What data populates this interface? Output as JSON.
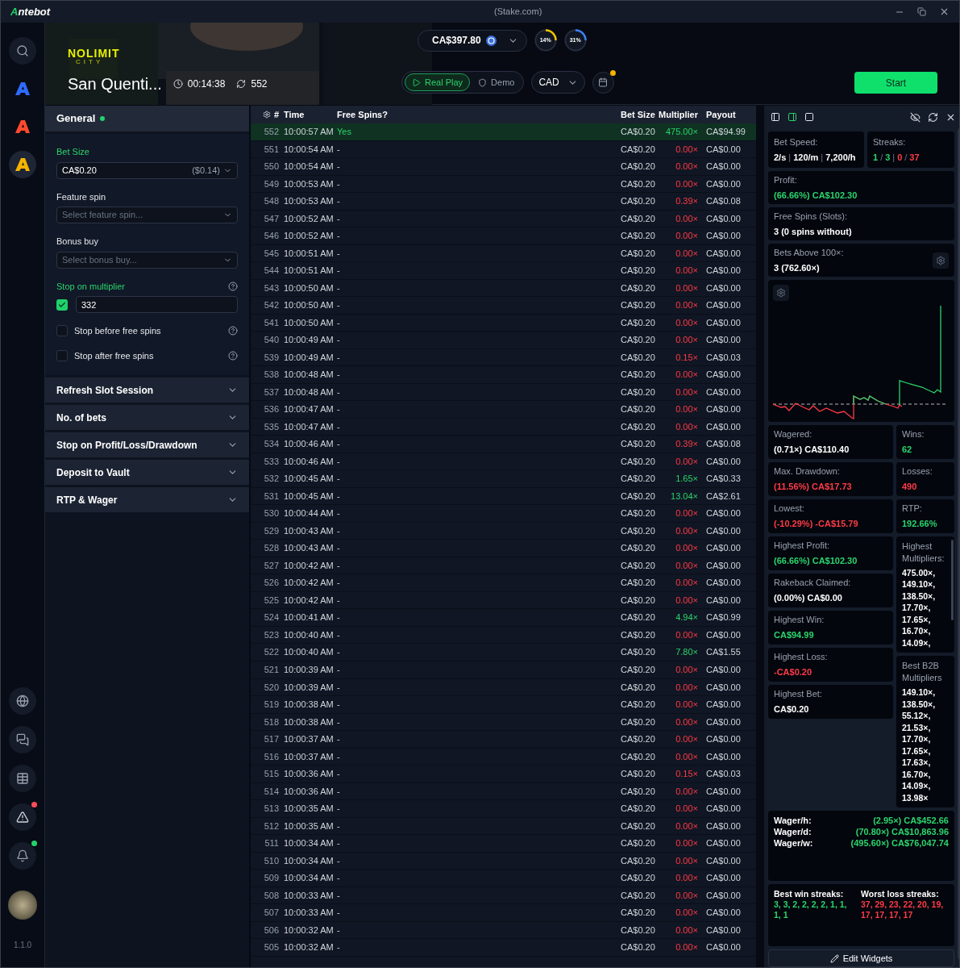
{
  "title_bar": {
    "app_name": "Antebot",
    "site": "(Stake.com)"
  },
  "sidebar": {
    "top_items": [
      {
        "kind": "search",
        "selected": false
      },
      {
        "kind": "logo",
        "color": "#2f6bff",
        "selected": false
      },
      {
        "kind": "logo",
        "color": "#ff4a2e",
        "selected": false
      },
      {
        "kind": "logo",
        "color": "#f5b400",
        "selected": true
      }
    ],
    "bottom_items": [
      {
        "kind": "globe"
      },
      {
        "kind": "chat"
      },
      {
        "kind": "table"
      },
      {
        "kind": "warning",
        "color": "#ff4d5a"
      },
      {
        "kind": "bell",
        "color": "#22d36b"
      }
    ],
    "version": "1.1.0"
  },
  "header": {
    "provider": {
      "name": "NOLIMIT",
      "sub": "CITY"
    },
    "game_title": "San Quenti...",
    "elapsed": "00:14:38",
    "spins": "552",
    "balance": "CA$397.80",
    "gauges": [
      {
        "reading": "14%",
        "color": "#f5c400"
      },
      {
        "reading": "31%",
        "color": "#3b82f6"
      }
    ],
    "modes": [
      {
        "label": "Real Play",
        "selected": true
      },
      {
        "label": "Demo",
        "selected": false
      }
    ],
    "currency": "CAD",
    "calendar_badge": true,
    "start": "Start"
  },
  "settings": {
    "general": {
      "title": "General",
      "active": true,
      "fields": [
        {
          "kind": "select",
          "label": "Bet Size",
          "active": true,
          "value": "CA$0.20",
          "note": "($0.14)"
        },
        {
          "kind": "select",
          "label": "Feature spin",
          "active": false,
          "placeholder": "Select feature spin..."
        },
        {
          "kind": "select",
          "label": "Bonus buy",
          "active": false,
          "placeholder": "Select bonus buy..."
        },
        {
          "kind": "multiplier",
          "label": "Stop on multiplier",
          "active": true,
          "checked": true,
          "value": "332",
          "help": true
        },
        {
          "kind": "checkbox",
          "label": "Stop before free spins",
          "checked": false,
          "help": true
        },
        {
          "kind": "checkbox",
          "label": "Stop after free spins",
          "checked": false,
          "help": true
        }
      ]
    },
    "sections": [
      {
        "title": "Refresh Slot Session",
        "expanded": false
      },
      {
        "title": "No. of bets",
        "expanded": false
      },
      {
        "title": "Stop on Profit/Loss/Drawdown",
        "expanded": false
      },
      {
        "title": "Deposit to Vault",
        "expanded": false
      },
      {
        "title": "RTP & Wager",
        "expanded": false
      }
    ]
  },
  "table": {
    "columns": [
      "#",
      "Time",
      "Free Spins?",
      "Bet Size",
      "Multiplier",
      "Payout"
    ],
    "rows": [
      {
        "n": "552",
        "time": "10:00:57 AM",
        "free": "Yes",
        "bet": "CA$0.20",
        "mult": "475.00×",
        "payout": "CA$94.99",
        "win": true,
        "selected": true
      },
      {
        "n": "551",
        "time": "10:00:54 AM",
        "free": "-",
        "bet": "CA$0.20",
        "mult": "0.00×",
        "payout": "CA$0.00",
        "win": false,
        "selected": false
      },
      {
        "n": "550",
        "time": "10:00:54 AM",
        "free": "-",
        "bet": "CA$0.20",
        "mult": "0.00×",
        "payout": "CA$0.00",
        "win": false,
        "selected": false
      },
      {
        "n": "549",
        "time": "10:00:53 AM",
        "free": "-",
        "bet": "CA$0.20",
        "mult": "0.00×",
        "payout": "CA$0.00",
        "win": false,
        "selected": false
      },
      {
        "n": "548",
        "time": "10:00:53 AM",
        "free": "-",
        "bet": "CA$0.20",
        "mult": "0.39×",
        "payout": "CA$0.08",
        "win": false,
        "selected": false
      },
      {
        "n": "547",
        "time": "10:00:52 AM",
        "free": "-",
        "bet": "CA$0.20",
        "mult": "0.00×",
        "payout": "CA$0.00",
        "win": false,
        "selected": false
      },
      {
        "n": "546",
        "time": "10:00:52 AM",
        "free": "-",
        "bet": "CA$0.20",
        "mult": "0.00×",
        "payout": "CA$0.00",
        "win": false,
        "selected": false
      },
      {
        "n": "545",
        "time": "10:00:51 AM",
        "free": "-",
        "bet": "CA$0.20",
        "mult": "0.00×",
        "payout": "CA$0.00",
        "win": false,
        "selected": false
      },
      {
        "n": "544",
        "time": "10:00:51 AM",
        "free": "-",
        "bet": "CA$0.20",
        "mult": "0.00×",
        "payout": "CA$0.00",
        "win": false,
        "selected": false
      },
      {
        "n": "543",
        "time": "10:00:50 AM",
        "free": "-",
        "bet": "CA$0.20",
        "mult": "0.00×",
        "payout": "CA$0.00",
        "win": false,
        "selected": false
      },
      {
        "n": "542",
        "time": "10:00:50 AM",
        "free": "-",
        "bet": "CA$0.20",
        "mult": "0.00×",
        "payout": "CA$0.00",
        "win": false,
        "selected": false
      },
      {
        "n": "541",
        "time": "10:00:50 AM",
        "free": "-",
        "bet": "CA$0.20",
        "mult": "0.00×",
        "payout": "CA$0.00",
        "win": false,
        "selected": false
      },
      {
        "n": "540",
        "time": "10:00:49 AM",
        "free": "-",
        "bet": "CA$0.20",
        "mult": "0.00×",
        "payout": "CA$0.00",
        "win": false,
        "selected": false
      },
      {
        "n": "539",
        "time": "10:00:49 AM",
        "free": "-",
        "bet": "CA$0.20",
        "mult": "0.15×",
        "payout": "CA$0.03",
        "win": false,
        "selected": false
      },
      {
        "n": "538",
        "time": "10:00:48 AM",
        "free": "-",
        "bet": "CA$0.20",
        "mult": "0.00×",
        "payout": "CA$0.00",
        "win": false,
        "selected": false
      },
      {
        "n": "537",
        "time": "10:00:48 AM",
        "free": "-",
        "bet": "CA$0.20",
        "mult": "0.00×",
        "payout": "CA$0.00",
        "win": false,
        "selected": false
      },
      {
        "n": "536",
        "time": "10:00:47 AM",
        "free": "-",
        "bet": "CA$0.20",
        "mult": "0.00×",
        "payout": "CA$0.00",
        "win": false,
        "selected": false
      },
      {
        "n": "535",
        "time": "10:00:47 AM",
        "free": "-",
        "bet": "CA$0.20",
        "mult": "0.00×",
        "payout": "CA$0.00",
        "win": false,
        "selected": false
      },
      {
        "n": "534",
        "time": "10:00:46 AM",
        "free": "-",
        "bet": "CA$0.20",
        "mult": "0.39×",
        "payout": "CA$0.08",
        "win": false,
        "selected": false
      },
      {
        "n": "533",
        "time": "10:00:46 AM",
        "free": "-",
        "bet": "CA$0.20",
        "mult": "0.00×",
        "payout": "CA$0.00",
        "win": false,
        "selected": false
      },
      {
        "n": "532",
        "time": "10:00:45 AM",
        "free": "-",
        "bet": "CA$0.20",
        "mult": "1.65×",
        "payout": "CA$0.33",
        "win": true,
        "selected": false
      },
      {
        "n": "531",
        "time": "10:00:45 AM",
        "free": "-",
        "bet": "CA$0.20",
        "mult": "13.04×",
        "payout": "CA$2.61",
        "win": true,
        "selected": false
      },
      {
        "n": "530",
        "time": "10:00:44 AM",
        "free": "-",
        "bet": "CA$0.20",
        "mult": "0.00×",
        "payout": "CA$0.00",
        "win": false,
        "selected": false
      },
      {
        "n": "529",
        "time": "10:00:43 AM",
        "free": "-",
        "bet": "CA$0.20",
        "mult": "0.00×",
        "payout": "CA$0.00",
        "win": false,
        "selected": false
      },
      {
        "n": "528",
        "time": "10:00:43 AM",
        "free": "-",
        "bet": "CA$0.20",
        "mult": "0.00×",
        "payout": "CA$0.00",
        "win": false,
        "selected": false
      },
      {
        "n": "527",
        "time": "10:00:42 AM",
        "free": "-",
        "bet": "CA$0.20",
        "mult": "0.00×",
        "payout": "CA$0.00",
        "win": false,
        "selected": false
      },
      {
        "n": "526",
        "time": "10:00:42 AM",
        "free": "-",
        "bet": "CA$0.20",
        "mult": "0.00×",
        "payout": "CA$0.00",
        "win": false,
        "selected": false
      },
      {
        "n": "525",
        "time": "10:00:42 AM",
        "free": "-",
        "bet": "CA$0.20",
        "mult": "0.00×",
        "payout": "CA$0.00",
        "win": false,
        "selected": false
      },
      {
        "n": "524",
        "time": "10:00:41 AM",
        "free": "-",
        "bet": "CA$0.20",
        "mult": "4.94×",
        "payout": "CA$0.99",
        "win": true,
        "selected": false
      },
      {
        "n": "523",
        "time": "10:00:40 AM",
        "free": "-",
        "bet": "CA$0.20",
        "mult": "0.00×",
        "payout": "CA$0.00",
        "win": false,
        "selected": false
      },
      {
        "n": "522",
        "time": "10:00:40 AM",
        "free": "-",
        "bet": "CA$0.20",
        "mult": "7.80×",
        "payout": "CA$1.55",
        "win": true,
        "selected": false
      },
      {
        "n": "521",
        "time": "10:00:39 AM",
        "free": "-",
        "bet": "CA$0.20",
        "mult": "0.00×",
        "payout": "CA$0.00",
        "win": false,
        "selected": false
      },
      {
        "n": "520",
        "time": "10:00:39 AM",
        "free": "-",
        "bet": "CA$0.20",
        "mult": "0.00×",
        "payout": "CA$0.00",
        "win": false,
        "selected": false
      },
      {
        "n": "519",
        "time": "10:00:38 AM",
        "free": "-",
        "bet": "CA$0.20",
        "mult": "0.00×",
        "payout": "CA$0.00",
        "win": false,
        "selected": false
      },
      {
        "n": "518",
        "time": "10:00:38 AM",
        "free": "-",
        "bet": "CA$0.20",
        "mult": "0.00×",
        "payout": "CA$0.00",
        "win": false,
        "selected": false
      },
      {
        "n": "517",
        "time": "10:00:37 AM",
        "free": "-",
        "bet": "CA$0.20",
        "mult": "0.00×",
        "payout": "CA$0.00",
        "win": false,
        "selected": false
      },
      {
        "n": "516",
        "time": "10:00:37 AM",
        "free": "-",
        "bet": "CA$0.20",
        "mult": "0.00×",
        "payout": "CA$0.00",
        "win": false,
        "selected": false
      },
      {
        "n": "515",
        "time": "10:00:36 AM",
        "free": "-",
        "bet": "CA$0.20",
        "mult": "0.15×",
        "payout": "CA$0.03",
        "win": false,
        "selected": false
      },
      {
        "n": "514",
        "time": "10:00:36 AM",
        "free": "-",
        "bet": "CA$0.20",
        "mult": "0.00×",
        "payout": "CA$0.00",
        "win": false,
        "selected": false
      },
      {
        "n": "513",
        "time": "10:00:35 AM",
        "free": "-",
        "bet": "CA$0.20",
        "mult": "0.00×",
        "payout": "CA$0.00",
        "win": false,
        "selected": false
      },
      {
        "n": "512",
        "time": "10:00:35 AM",
        "free": "-",
        "bet": "CA$0.20",
        "mult": "0.00×",
        "payout": "CA$0.00",
        "win": false,
        "selected": false
      },
      {
        "n": "511",
        "time": "10:00:34 AM",
        "free": "-",
        "bet": "CA$0.20",
        "mult": "0.00×",
        "payout": "CA$0.00",
        "win": false,
        "selected": false
      },
      {
        "n": "510",
        "time": "10:00:34 AM",
        "free": "-",
        "bet": "CA$0.20",
        "mult": "0.00×",
        "payout": "CA$0.00",
        "win": false,
        "selected": false
      },
      {
        "n": "509",
        "time": "10:00:34 AM",
        "free": "-",
        "bet": "CA$0.20",
        "mult": "0.00×",
        "payout": "CA$0.00",
        "win": false,
        "selected": false
      },
      {
        "n": "508",
        "time": "10:00:33 AM",
        "free": "-",
        "bet": "CA$0.20",
        "mult": "0.00×",
        "payout": "CA$0.00",
        "win": false,
        "selected": false
      },
      {
        "n": "507",
        "time": "10:00:33 AM",
        "free": "-",
        "bet": "CA$0.20",
        "mult": "0.00×",
        "payout": "CA$0.00",
        "win": false,
        "selected": false
      },
      {
        "n": "506",
        "time": "10:00:32 AM",
        "free": "-",
        "bet": "CA$0.20",
        "mult": "0.00×",
        "payout": "CA$0.00",
        "win": false,
        "selected": false
      },
      {
        "n": "505",
        "time": "10:00:32 AM",
        "free": "-",
        "bet": "CA$0.20",
        "mult": "0.00×",
        "payout": "CA$0.00",
        "win": false,
        "selected": false
      }
    ]
  },
  "widgets": {
    "layouts": [
      {
        "selected": false
      },
      {
        "selected": true
      },
      {
        "selected": false
      }
    ],
    "top": [
      {
        "label": "Bet Speed:",
        "parts": [
          {
            "text": "2/s",
            "color": "#ffffff"
          },
          {
            "text": "|"
          },
          {
            "text": "120/m",
            "color": "#ffffff"
          },
          {
            "text": "|"
          },
          {
            "text": "7,200/h",
            "color": "#ffffff"
          }
        ]
      },
      {
        "label": "Streaks:",
        "parts": [
          {
            "text": "1",
            "color": "#2bd46c"
          },
          {
            "text": "/"
          },
          {
            "text": "3",
            "color": "#2bd46c"
          },
          {
            "text": "|"
          },
          {
            "text": "0",
            "color": "#ff3b47"
          },
          {
            "text": "/"
          },
          {
            "text": "37",
            "color": "#ff3b47"
          }
        ]
      }
    ],
    "full": [
      {
        "label": "Profit:",
        "parts": [
          {
            "text": "(66.66%) CA$102.30",
            "color": "#2bd46c"
          }
        ],
        "gear": false
      },
      {
        "label": "Free Spins (Slots):",
        "parts": [
          {
            "text": "3 (0 spins without)",
            "color": "#ffffff"
          }
        ],
        "gear": false
      },
      {
        "label": "Bets Above 100×:",
        "parts": [
          {
            "text": "3 (762.60×)",
            "color": "#ffffff"
          }
        ],
        "gear": true
      }
    ],
    "left": [
      {
        "label": "Wagered:",
        "parts": [
          {
            "text": "(0.71×) CA$110.40",
            "color": "#ffffff"
          }
        ]
      },
      {
        "label": "Max. Drawdown:",
        "parts": [
          {
            "text": "(11.56%) CA$17.73",
            "color": "#ff3b47"
          }
        ]
      },
      {
        "label": "Lowest:",
        "parts": [
          {
            "text": "(-10.29%) -CA$15.79",
            "color": "#ff3b47"
          }
        ]
      },
      {
        "label": "Highest Profit:",
        "parts": [
          {
            "text": "(66.66%) CA$102.30",
            "color": "#2bd46c"
          }
        ]
      },
      {
        "label": "Rakeback Claimed:",
        "parts": [
          {
            "text": "(0.00%) CA$0.00",
            "color": "#ffffff"
          }
        ]
      },
      {
        "label": "Highest Win:",
        "parts": [
          {
            "text": "CA$94.99",
            "color": "#2bd46c"
          }
        ]
      },
      {
        "label": "Highest Loss:",
        "parts": [
          {
            "text": "-CA$0.20",
            "color": "#ff3b47"
          }
        ]
      },
      {
        "label": "Highest Bet:",
        "parts": [
          {
            "text": "CA$0.20",
            "color": "#ffffff"
          }
        ]
      }
    ],
    "right": [
      {
        "kind": "stat",
        "label": "Wins:",
        "parts": [
          {
            "text": "62",
            "color": "#2bd46c"
          }
        ]
      },
      {
        "kind": "stat",
        "label": "Losses:",
        "parts": [
          {
            "text": "490",
            "color": "#ff3b47"
          }
        ]
      },
      {
        "kind": "stat",
        "label": "RTP:",
        "parts": [
          {
            "text": "192.66%",
            "color": "#2bd46c"
          }
        ]
      },
      {
        "kind": "list",
        "label": "Highest Multipliers:",
        "scroll": true,
        "items": [
          "475.00×,",
          "149.10×,",
          "138.50×,",
          "17.70×,",
          "17.65×,",
          "16.70×,",
          "14.09×,"
        ]
      },
      {
        "kind": "list",
        "label": "Best B2B Multipliers",
        "scroll": false,
        "items": [
          "149.10×,",
          "138.50×,",
          "55.12×,",
          "21.53×,",
          "17.70×,",
          "17.65×,",
          "17.63×,",
          "16.70×,",
          "14.09×,",
          "13.98×"
        ]
      }
    ],
    "wager": [
      {
        "label": "Wager/h:",
        "value": "(2.95×) CA$452.66"
      },
      {
        "label": "Wager/d:",
        "value": "(70.80×) CA$10,863.96"
      },
      {
        "label": "Wager/w:",
        "value": "(495.60×) CA$76,047.74"
      }
    ],
    "streaks": [
      {
        "label": "Best win streaks:",
        "value": "3, 3, 2, 2, 2, 2, 1, 1, 1, 1",
        "color": "#2bd46c"
      },
      {
        "label": "Worst loss streaks:",
        "value": "37, 29, 23, 22, 20, 19, 17, 17, 17, 17",
        "color": "#ff3b47"
      }
    ],
    "edit": "Edit Widgets"
  }
}
